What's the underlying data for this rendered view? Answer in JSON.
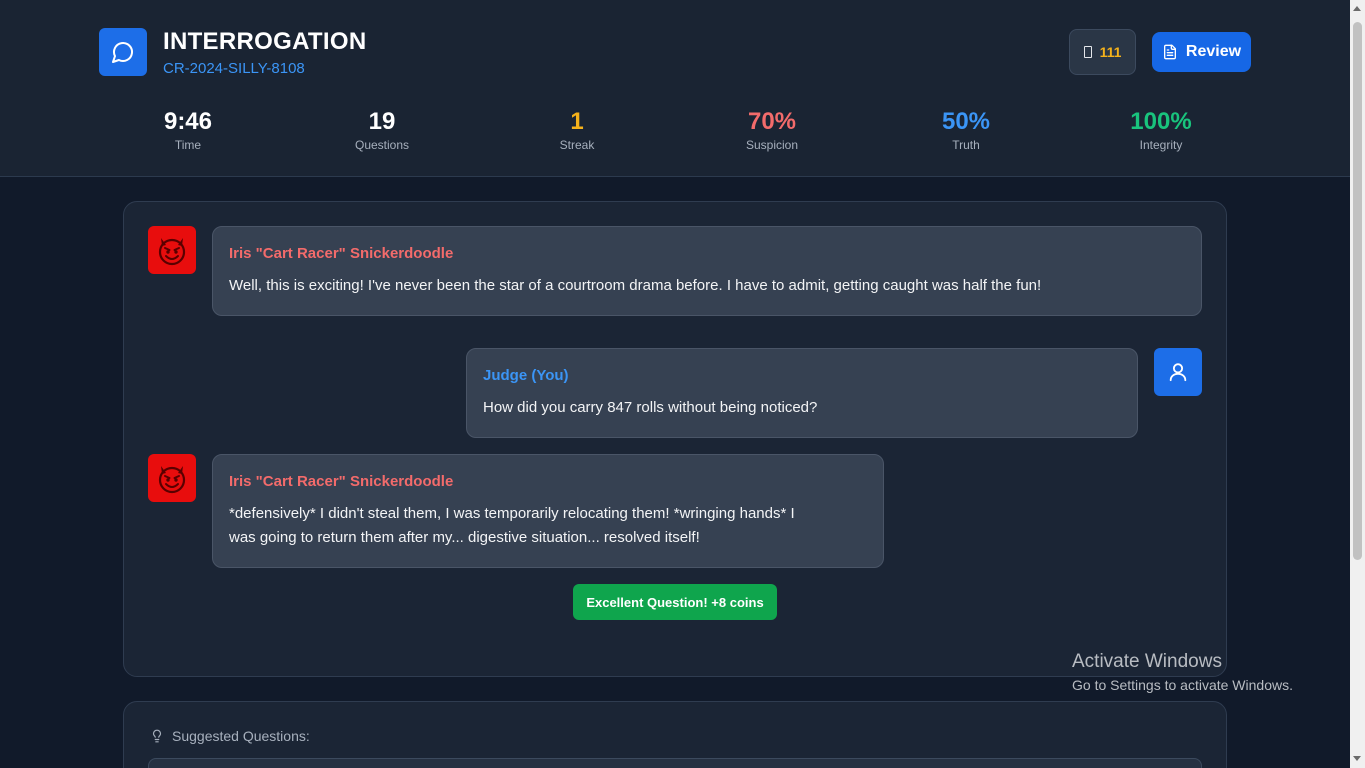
{
  "header": {
    "title": "INTERROGATION",
    "case_id": "CR-2024-SILLY-8108",
    "coins": "111",
    "review_label": "Review",
    "progress_fraction": 0.2
  },
  "stats": [
    {
      "value": "9:46",
      "label": "Time",
      "color": "#ffffff"
    },
    {
      "value": "19",
      "label": "Questions",
      "color": "#ffffff"
    },
    {
      "value": "1",
      "label": "Streak",
      "color": "#f5b21b"
    },
    {
      "value": "70%",
      "label": "Suspicion",
      "color": "#f36b6b"
    },
    {
      "value": "50%",
      "label": "Truth",
      "color": "#3b95f6"
    },
    {
      "value": "100%",
      "label": "Integrity",
      "color": "#19c37d"
    }
  ],
  "messages": [
    {
      "sender": "Iris \"Cart Racer\" Snickerdoodle",
      "role": "suspect",
      "text": "Well, this is exciting! I've never been the star of a courtroom drama before. I have to admit, getting caught was half the fun!"
    },
    {
      "sender": "Judge (You)",
      "role": "judge",
      "text": "How did you carry 847 rolls without being noticed?"
    },
    {
      "sender": "Iris \"Cart Racer\" Snickerdoodle",
      "role": "suspect",
      "text_lines": [
        "*defensively* I didn't steal them, I was temporarily relocating them! *wringing hands* I",
        "was going to return them after my... digestive situation... resolved itself!"
      ]
    }
  ],
  "reward": "Excellent Question! +8 coins",
  "suggestions": {
    "heading": "Suggested Questions:"
  },
  "watermark": {
    "line1": "Activate Windows",
    "line2": "Go to Settings to activate Windows."
  },
  "icons": {
    "app": "chat-bubble-icon",
    "review": "document-icon",
    "coins": "coin-icon",
    "suspect_avatar": "devil-face-icon",
    "judge_avatar": "user-icon",
    "suggest": "lightbulb-icon"
  }
}
